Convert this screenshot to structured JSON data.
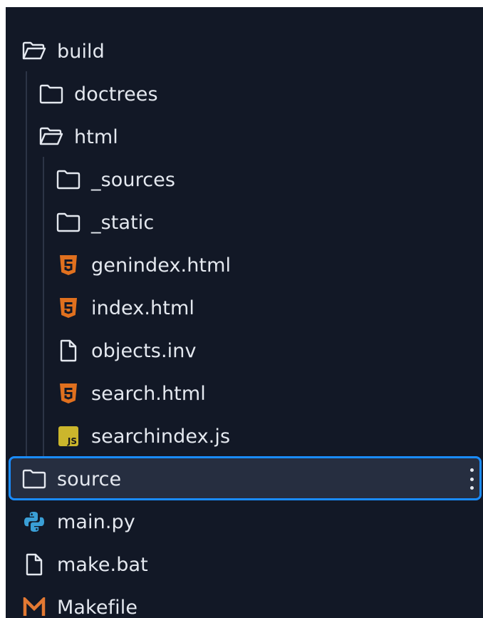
{
  "explorer": {
    "items": [
      {
        "label": "build",
        "icon": "folder-open-icon",
        "depth": 0
      },
      {
        "label": "doctrees",
        "icon": "folder-icon",
        "depth": 1
      },
      {
        "label": "html",
        "icon": "folder-open-icon",
        "depth": 1
      },
      {
        "label": "_sources",
        "icon": "folder-icon",
        "depth": 2
      },
      {
        "label": "_static",
        "icon": "folder-icon",
        "depth": 2
      },
      {
        "label": "genindex.html",
        "icon": "html5-icon",
        "depth": 2
      },
      {
        "label": "index.html",
        "icon": "html5-icon",
        "depth": 2
      },
      {
        "label": "objects.inv",
        "icon": "file-icon",
        "depth": 2
      },
      {
        "label": "search.html",
        "icon": "html5-icon",
        "depth": 2
      },
      {
        "label": "searchindex.js",
        "icon": "js-icon",
        "depth": 2
      },
      {
        "label": "source",
        "icon": "folder-icon",
        "depth": 0,
        "selected": true
      },
      {
        "label": "main.py",
        "icon": "python-icon",
        "depth": 0
      },
      {
        "label": "make.bat",
        "icon": "file-icon",
        "depth": 0
      },
      {
        "label": "Makefile",
        "icon": "makefile-icon",
        "depth": 0
      }
    ],
    "js_badge_text": "JS",
    "colors": {
      "background": "#121826",
      "text": "#e4e8ef",
      "selection_border": "#1a8cff",
      "selection_fill": "#262e40",
      "html_icon": "#e0701e",
      "js_icon": "#cbb62c",
      "makefile_icon": "#e37933",
      "python_icon": "#3a9fd6"
    }
  }
}
